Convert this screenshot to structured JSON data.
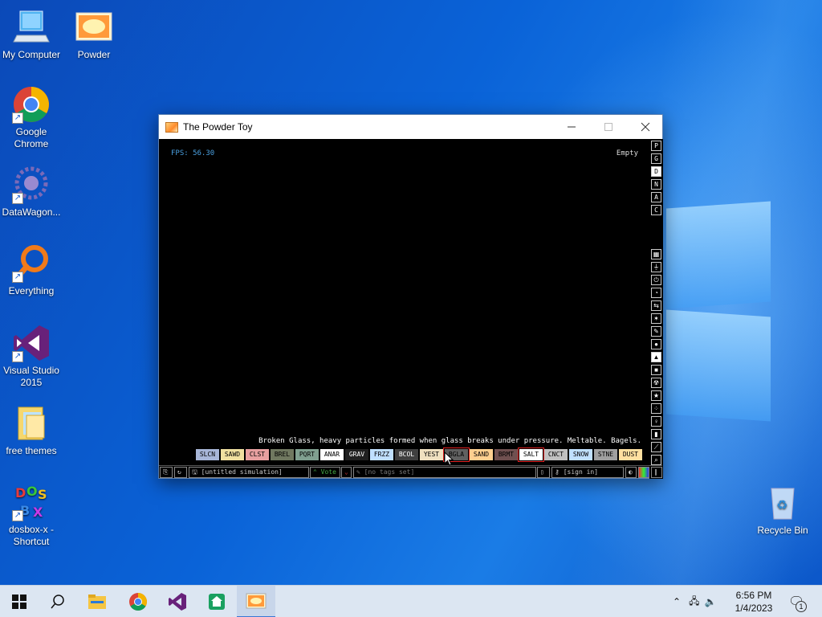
{
  "desktop": {
    "icons": [
      {
        "label": "My Computer"
      },
      {
        "label": "Powder"
      },
      {
        "label": "Google Chrome"
      },
      {
        "label": "DataWagon..."
      },
      {
        "label": "Everything"
      },
      {
        "label": "Visual Studio 2015"
      },
      {
        "label": "free themes"
      },
      {
        "label": "dosbox-x - Shortcut"
      },
      {
        "label": "Recycle Bin"
      }
    ]
  },
  "window": {
    "title": "The Powder Toy",
    "fps": "FPS: 56.30",
    "hover": "Empty",
    "description": "Broken Glass, heavy particles formed when glass breaks under pressure. Meltable. Bagels.",
    "modes": [
      "P",
      "G",
      "D",
      "N",
      "A",
      "C"
    ],
    "active_mode": "D",
    "elements": [
      {
        "label": "SLCN",
        "bg": "#a8b6d8",
        "fg": "#000"
      },
      {
        "label": "SAWD",
        "bg": "#f0e0a0",
        "fg": "#000"
      },
      {
        "label": "CLST",
        "bg": "#e8a0a0",
        "fg": "#000"
      },
      {
        "label": "BREL",
        "bg": "#707860",
        "fg": "#000"
      },
      {
        "label": "PQRT",
        "bg": "#80a090",
        "fg": "#000"
      },
      {
        "label": "ANAR",
        "bg": "#ffffff",
        "fg": "#000"
      },
      {
        "label": "GRAV",
        "bg": "#202020",
        "fg": "#fff"
      },
      {
        "label": "FRZZ",
        "bg": "#c0e0ff",
        "fg": "#000"
      },
      {
        "label": "BCOL",
        "bg": "#404040",
        "fg": "#fff"
      },
      {
        "label": "YEST",
        "bg": "#f0e0c0",
        "fg": "#000"
      },
      {
        "label": "BGLA",
        "bg": "#606060",
        "fg": "#000"
      },
      {
        "label": "SAND",
        "bg": "#ffd090",
        "fg": "#000"
      },
      {
        "label": "BRMT",
        "bg": "#705050",
        "fg": "#000"
      },
      {
        "label": "SALT",
        "bg": "#ffffff",
        "fg": "#000"
      },
      {
        "label": "CNCT",
        "bg": "#c0c0c0",
        "fg": "#000"
      },
      {
        "label": "SNOW",
        "bg": "#c0e0ff",
        "fg": "#000"
      },
      {
        "label": "STNE",
        "bg": "#a0a0a0",
        "fg": "#000"
      },
      {
        "label": "DUST",
        "bg": "#ffe0a0",
        "fg": "#000"
      }
    ],
    "selected_primary": "BGLA",
    "selected_secondary": "SALT",
    "bottom": {
      "sim_name": "[untitled simulation]",
      "vote_label": "Vote",
      "tags": "[no tags set]",
      "sign_in": "[sign in]"
    }
  },
  "taskbar": {
    "time": "6:56 PM",
    "date": "1/4/2023",
    "notifications": "1"
  }
}
